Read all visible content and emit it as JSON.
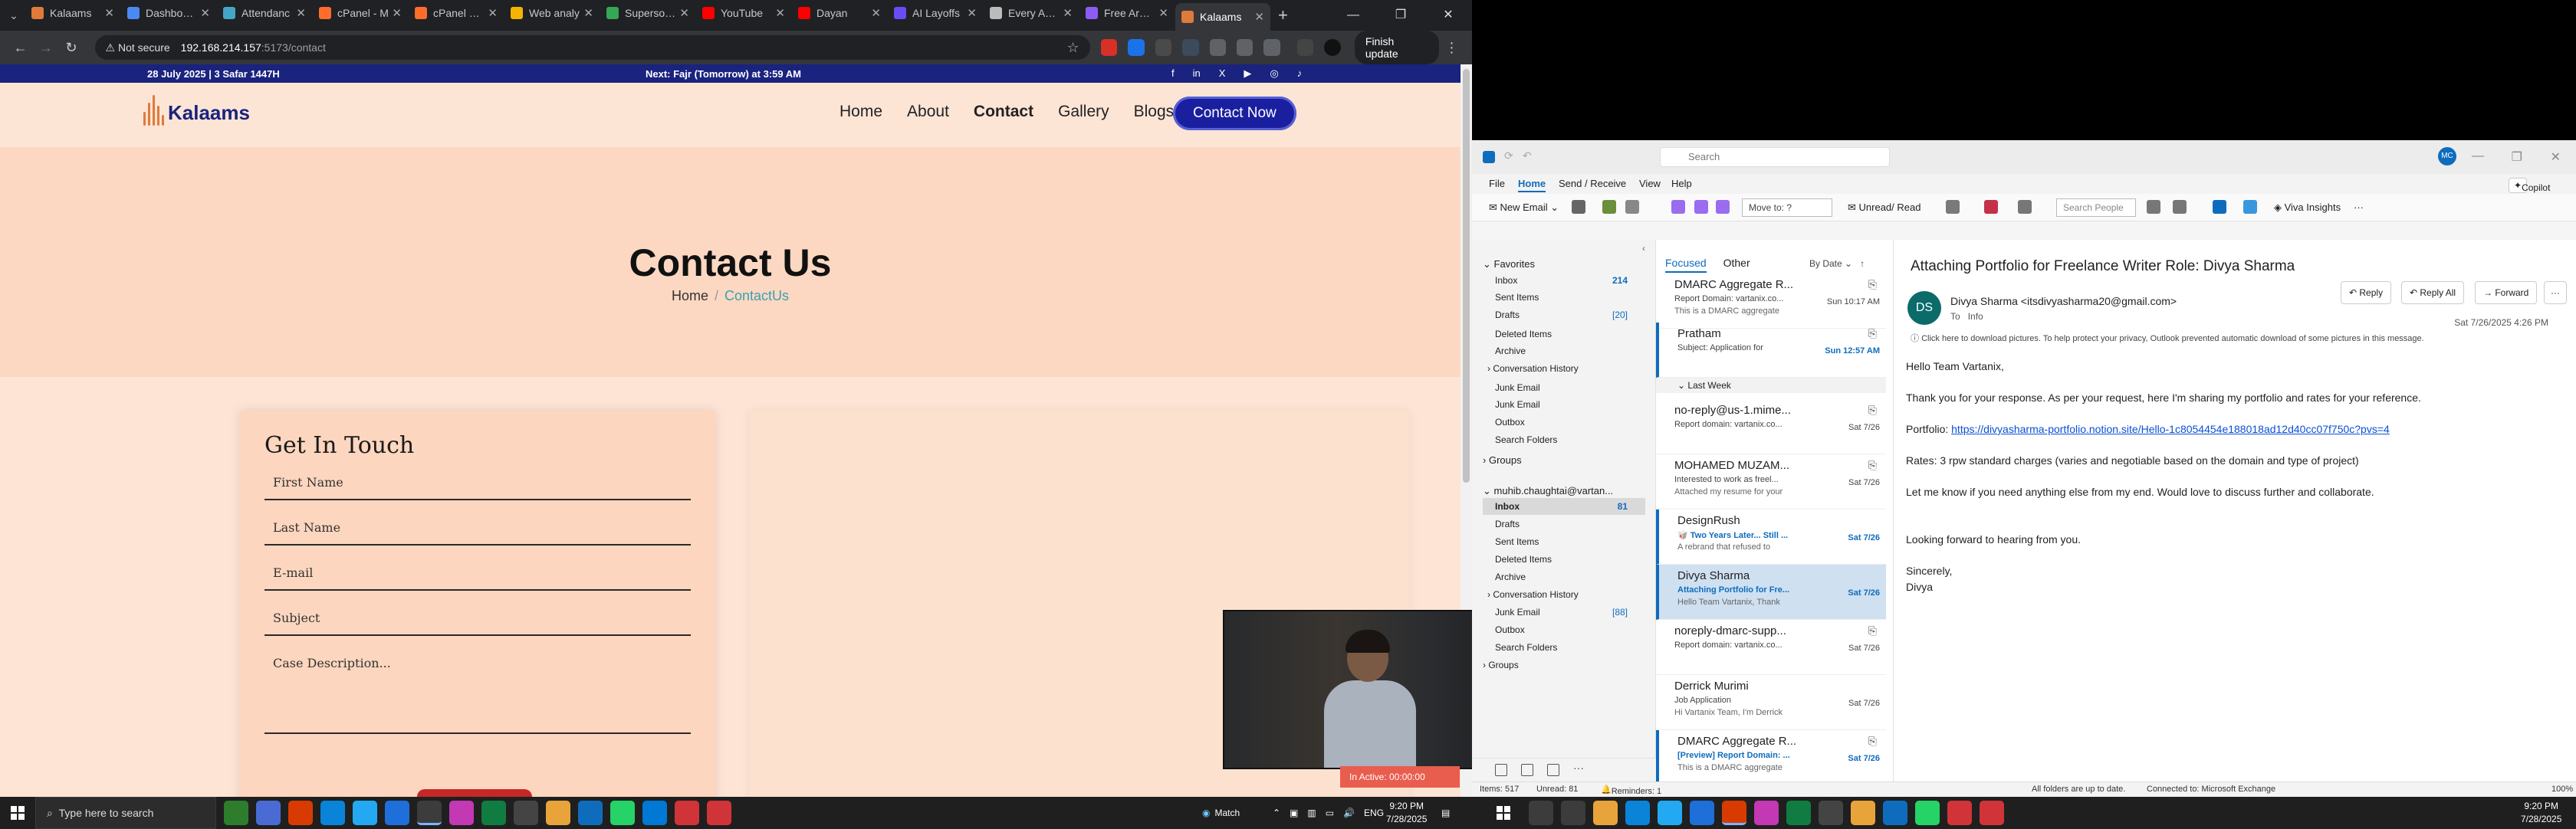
{
  "browser": {
    "tabs": [
      {
        "label": "Kalaams",
        "color": "#e07a3a"
      },
      {
        "label": "Dashboard",
        "color": "#4a8af4"
      },
      {
        "label": "Attendanc",
        "color": "#43a6c6"
      },
      {
        "label": "cPanel - M",
        "color": "#ff6c2c"
      },
      {
        "label": "cPanel File",
        "color": "#ff6c2c"
      },
      {
        "label": "Web analy",
        "color": "#f4b400"
      },
      {
        "label": "Supersonic",
        "color": "#34a853"
      },
      {
        "label": "YouTube",
        "color": "#ff0000"
      },
      {
        "label": "Dayan",
        "color": "#ff0000"
      },
      {
        "label": "AI Layoffs",
        "color": "#6a4cf5"
      },
      {
        "label": "Every Ayah",
        "color": "#bbbbbb"
      },
      {
        "label": "Free Arabic",
        "color": "#8e5cf5"
      },
      {
        "label": "Kalaams",
        "color": "#e07a3a",
        "active": true
      }
    ],
    "security": "Not secure",
    "url_host": "192.168.214.157",
    "url_path": ":5173/contact",
    "update_label": "Finish update"
  },
  "site": {
    "date_text": "28 July 2025 | 3 Safar 1447H",
    "prayer_text": "Next: Fajr (Tomorrow) at 3:59 AM",
    "social": [
      "f",
      "in",
      "X",
      "▶",
      "◎",
      "♪"
    ],
    "brand": "Kalaams",
    "nav": [
      "Home",
      "About",
      "Contact",
      "Gallery",
      "Blogs"
    ],
    "cta": "Contact Now",
    "hero_title": "Contact Us",
    "crumb_home": "Home",
    "crumb_sep": "/",
    "crumb_current": "ContactUs",
    "form_title": "Get In Touch",
    "fields": [
      "First Name",
      "Last Name",
      "E-mail",
      "Subject",
      "Case Description..."
    ]
  },
  "video": {
    "inactive_label": "In Active: 00:00:00"
  },
  "outlook": {
    "search_placeholder": "Search",
    "avatar": "MC",
    "menu": [
      "File",
      "Home",
      "Send / Receive",
      "View",
      "Help"
    ],
    "copilot": "Copilot",
    "ribbon": {
      "new_email": "New Email",
      "move_to": "Move to: ?",
      "unread_read": "Unread/ Read",
      "search_people": "Search People",
      "viva": "Viva Insights"
    },
    "folders": {
      "favorites_label": "Favorites",
      "favorites": [
        {
          "name": "Inbox",
          "count": "214"
        },
        {
          "name": "Sent Items",
          "count": ""
        },
        {
          "name": "Drafts",
          "count": "[20]"
        },
        {
          "name": "Deleted Items",
          "count": ""
        },
        {
          "name": "Archive",
          "count": ""
        },
        {
          "name": "Conversation History",
          "count": ""
        },
        {
          "name": "Junk Email",
          "count": ""
        },
        {
          "name": "Junk Email",
          "count": ""
        },
        {
          "name": "Outbox",
          "count": ""
        },
        {
          "name": "Search Folders",
          "count": ""
        }
      ],
      "groups_label": "Groups",
      "account": "muhib.chaughtai@vartan...",
      "account_folders": [
        {
          "name": "Inbox",
          "count": "81"
        },
        {
          "name": "Drafts",
          "count": ""
        },
        {
          "name": "Sent Items",
          "count": ""
        },
        {
          "name": "Deleted Items",
          "count": ""
        },
        {
          "name": "Archive",
          "count": ""
        },
        {
          "name": "Conversation History",
          "count": ""
        },
        {
          "name": "Junk Email",
          "count": "[88]"
        },
        {
          "name": "Outbox",
          "count": ""
        },
        {
          "name": "Search Folders",
          "count": ""
        },
        {
          "name": "Groups",
          "count": ""
        }
      ]
    },
    "list": {
      "tab_focused": "Focused",
      "tab_other": "Other",
      "sort": "By Date",
      "last_week": "Last Week",
      "messages": [
        {
          "from": "DMARC Aggregate R...",
          "subject": "Report Domain: vartanix.co...",
          "preview": "This is a DMARC aggregate",
          "date": "Sun 10:17 AM",
          "attach": true,
          "unread": false,
          "blue_date": false,
          "blue_subject": false
        },
        {
          "from": "Pratham",
          "subject": "Subject: Application for",
          "preview": "",
          "date": "Sun 12:57 AM",
          "attach": true,
          "unread": true,
          "blue_date": true,
          "blue_subject": false
        },
        {
          "from": "no-reply@us-1.mime...",
          "subject": "Report domain: vartanix.co...",
          "preview": "",
          "date": "Sat 7/26",
          "attach": true,
          "unread": false,
          "blue_date": false,
          "blue_subject": false
        },
        {
          "from": "MOHAMED MUZAM...",
          "subject": "Interested to work as freel...",
          "preview": "Attached my resume for your",
          "date": "Sat 7/26",
          "attach": true,
          "unread": false,
          "blue_date": false,
          "blue_subject": false
        },
        {
          "from": "DesignRush",
          "subject": "🥡 Two Years Later... Still ...",
          "preview": "A rebrand that refused to",
          "date": "Sat 7/26",
          "attach": false,
          "unread": true,
          "blue_date": true,
          "blue_subject": true
        },
        {
          "from": "Divya Sharma",
          "subject": "Attaching Portfolio for Fre...",
          "preview": "Hello Team Vartanix,  Thank",
          "date": "Sat 7/26",
          "attach": false,
          "unread": true,
          "blue_date": true,
          "blue_subject": true,
          "selected": true
        },
        {
          "from": "noreply-dmarc-supp...",
          "subject": "Report domain: vartanix.co...",
          "preview": "",
          "date": "Sat 7/26",
          "attach": true,
          "unread": false,
          "blue_date": false,
          "blue_subject": false
        },
        {
          "from": "Derrick Murimi",
          "subject": "Job Application",
          "preview": "Hi Vartanix Team,  I'm Derrick",
          "date": "Sat 7/26",
          "attach": false,
          "unread": false,
          "blue_date": false,
          "blue_subject": false
        },
        {
          "from": "DMARC Aggregate R...",
          "subject": "[Preview] Report Domain: ...",
          "preview": "This is a DMARC aggregate",
          "date": "Sat 7/26",
          "attach": true,
          "unread": true,
          "blue_date": true,
          "blue_subject": true
        }
      ]
    },
    "reading": {
      "subject": "Attaching Portfolio for Freelance Writer Role: Divya Sharma",
      "avatar": "DS",
      "sender": "Divya Sharma <itsdivyasharma20@gmail.com>",
      "to_label": "To",
      "to_value": "Info",
      "date": "Sat 7/26/2025 4:26 PM",
      "info_bar": "Click here to download pictures. To help protect your privacy, Outlook prevented automatic download of some pictures in this message.",
      "reply": "Reply",
      "reply_all": "Reply All",
      "forward": "Forward",
      "greeting": "Hello Team Vartanix,",
      "line1": "Thank you for your response. As per your request, here I'm sharing my portfolio and rates for your reference.",
      "portfolio_label": "Portfolio:",
      "portfolio_link": "https://divyasharma-portfolio.notion.site/Hello-1c8054454e188018ad12d40cc07f750c?pvs=4",
      "rates": "Rates: 3 rpw standard charges (varies and negotiable based on the domain and type of project)",
      "line2": "Let me know if you need anything else from my end. Would love to discuss further and collaborate.",
      "line3": "Looking forward to hearing from you.",
      "signoff": "Sincerely,",
      "name": "Divya"
    },
    "status": {
      "items": "Items: 517",
      "unread": "Unread: 81",
      "reminders": "Reminders: 1",
      "folders_state": "All folders are up to date.",
      "connected": "Connected to: Microsoft Exchange",
      "zoom": "100%"
    }
  },
  "taskbar": {
    "search_placeholder": "Type here to search",
    "weather": "Match",
    "time": "9:20 PM",
    "date": "7/28/2025"
  }
}
